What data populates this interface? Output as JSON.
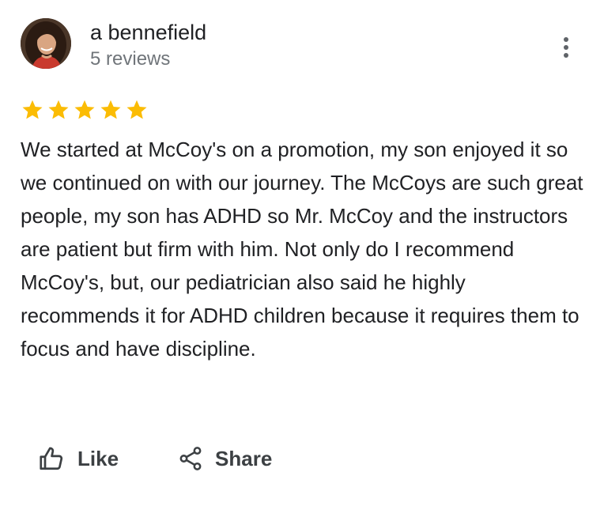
{
  "review": {
    "reviewer": {
      "name": "a bennefield",
      "meta": "5 reviews"
    },
    "rating": 5,
    "max_rating": 5,
    "text": "We started at McCoy's on a promotion, my son enjoyed it so we continued on with our journey. The McCoys are such great people, my son has ADHD so Mr. McCoy and the instructors are patient but firm with him. Not only do I recommend McCoy's, but, our pediatrician also said he highly recommends it for ADHD children because it requires them to focus and have discipline.",
    "actions": {
      "like_label": "Like",
      "share_label": "Share"
    }
  },
  "icons": {
    "menu": "more-vert-icon",
    "like": "thumb-up-icon",
    "share": "share-icon",
    "star": "star-icon"
  },
  "colors": {
    "star": "#fbbc04",
    "text": "#202124",
    "secondary_text": "#70757a",
    "action_text": "#3c4043"
  }
}
